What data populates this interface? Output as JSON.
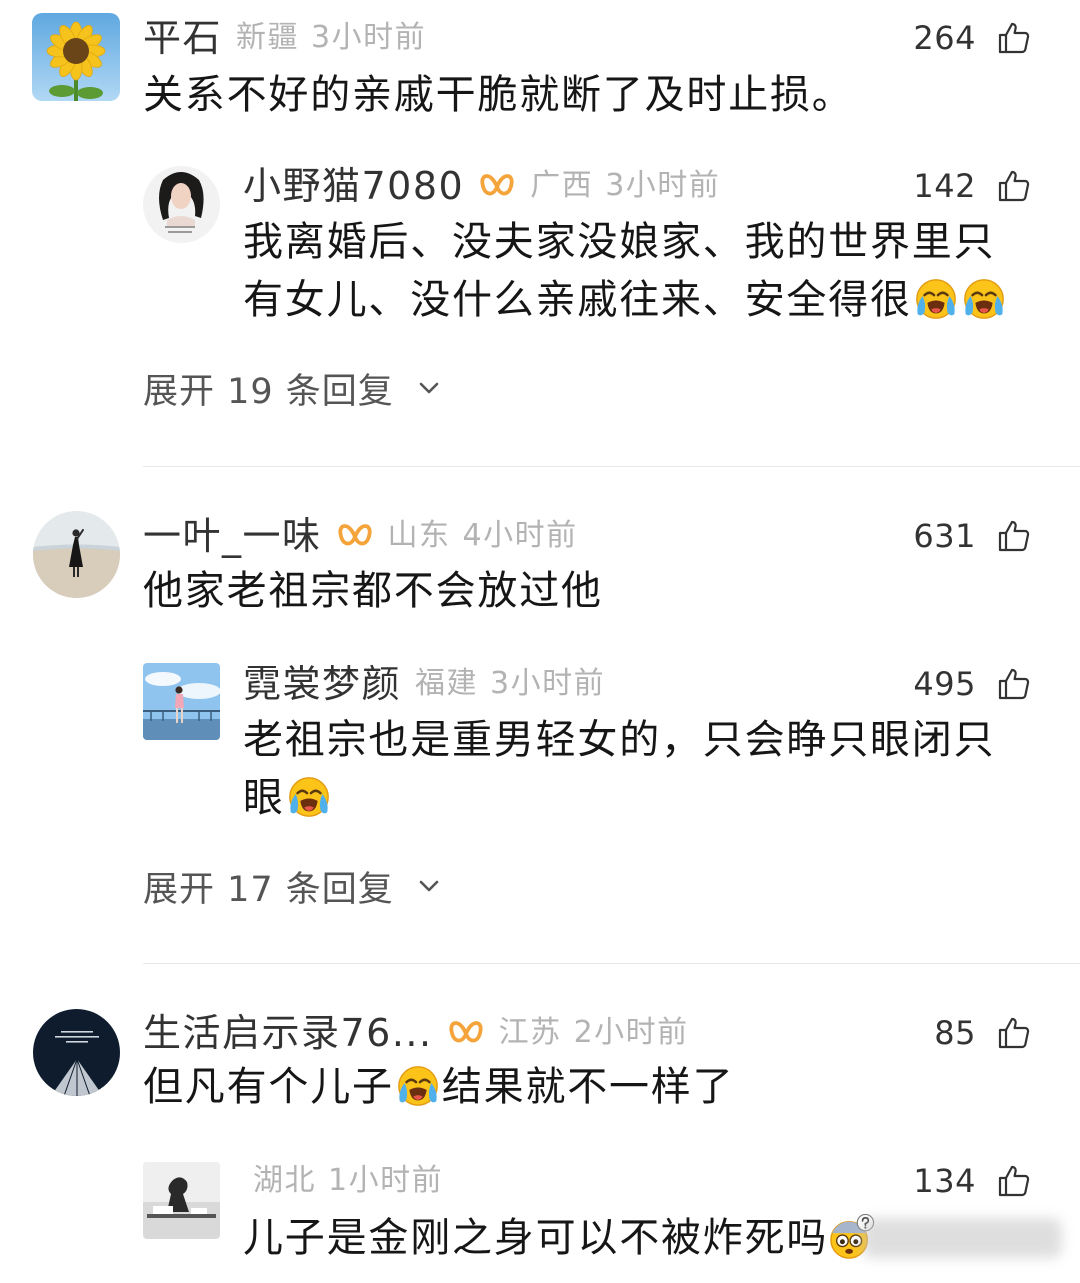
{
  "threads": [
    {
      "comment": {
        "name": "平石",
        "location": "新疆",
        "time": "3小时前",
        "likes": "264",
        "segments": [
          {
            "text": "关系不好的亲戚干脆就断了及时止损。"
          }
        ]
      },
      "reply": {
        "name": "小野猫7080",
        "badge": "fan-badge-icon",
        "location": "广西",
        "time": "3小时前",
        "likes": "142",
        "segments": [
          {
            "text": "我离婚后、没夫家没娘家、我的世界里只有女儿、没什么亲戚往来、安全得很"
          },
          {
            "emoji": "loudly-crying-face"
          },
          {
            "emoji": "loudly-crying-face"
          }
        ]
      },
      "expand_label": "展开 19 条回复"
    },
    {
      "comment": {
        "name": "一叶_一味",
        "badge": "fan-badge-icon",
        "location": "山东",
        "time": "4小时前",
        "likes": "631",
        "segments": [
          {
            "text": "他家老祖宗都不会放过他"
          }
        ]
      },
      "reply": {
        "name": "霓裳梦颜",
        "location": "福建",
        "time": "3小时前",
        "likes": "495",
        "segments": [
          {
            "text": "老祖宗也是重男轻女的，只会睁只眼闭只眼"
          },
          {
            "emoji": "loudly-crying-face"
          }
        ]
      },
      "expand_label": "展开 17 条回复"
    },
    {
      "comment": {
        "name": "生活启示录76...",
        "badge": "fan-badge-icon",
        "location": "江苏",
        "time": "2小时前",
        "likes": "85",
        "segments": [
          {
            "text": "但凡有个儿子"
          },
          {
            "emoji": "loudly-crying-face"
          },
          {
            "text": "结果就不一样了"
          }
        ]
      },
      "reply": {
        "location": "湖北",
        "time": "1小时前",
        "likes": "134",
        "segments": [
          {
            "text": "儿子是金刚之身可以不被炸死吗"
          },
          {
            "emoji": "confused-question-face"
          }
        ]
      }
    }
  ],
  "icons": {
    "like": "thumbs-up-icon",
    "expand": "chevron-down-icon",
    "badge": "fan-badge-icon"
  },
  "colors": {
    "badge": "#f4a43a",
    "name_text": "#333333",
    "meta_text": "#b3b3b3",
    "body_text": "#161616",
    "expand_text": "#555555",
    "divider": "#e8e8e8",
    "background": "#ffffff"
  }
}
